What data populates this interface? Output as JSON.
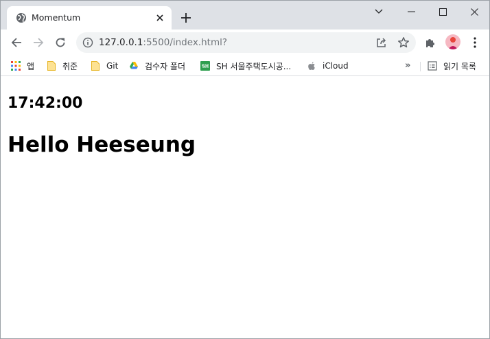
{
  "browser": {
    "tab": {
      "title": "Momentum",
      "favicon": "globe-icon"
    },
    "url": {
      "host": "127.0.0.1",
      "path": ":5500/index.html?"
    },
    "bookmarks": [
      {
        "label": "앱",
        "icon": "apps-grid-icon"
      },
      {
        "label": "취준",
        "icon": "folder-icon"
      },
      {
        "label": "Git",
        "icon": "folder-icon"
      },
      {
        "label": "검수자 폴더",
        "icon": "google-drive-icon"
      },
      {
        "label": "SH 서울주택도시공...",
        "icon": "sh-icon"
      },
      {
        "label": "iCloud",
        "icon": "apple-icon"
      }
    ],
    "reading_list": {
      "label": "읽기 목록",
      "icon": "reading-list-icon"
    },
    "colors": {
      "tabstrip": "#dee1e6",
      "omnibox": "#f1f3f4",
      "folder": "#fcd663",
      "avatar": "#f6b8c2"
    }
  },
  "page": {
    "clock": "17:42:00",
    "greeting": "Hello Heeseung"
  }
}
